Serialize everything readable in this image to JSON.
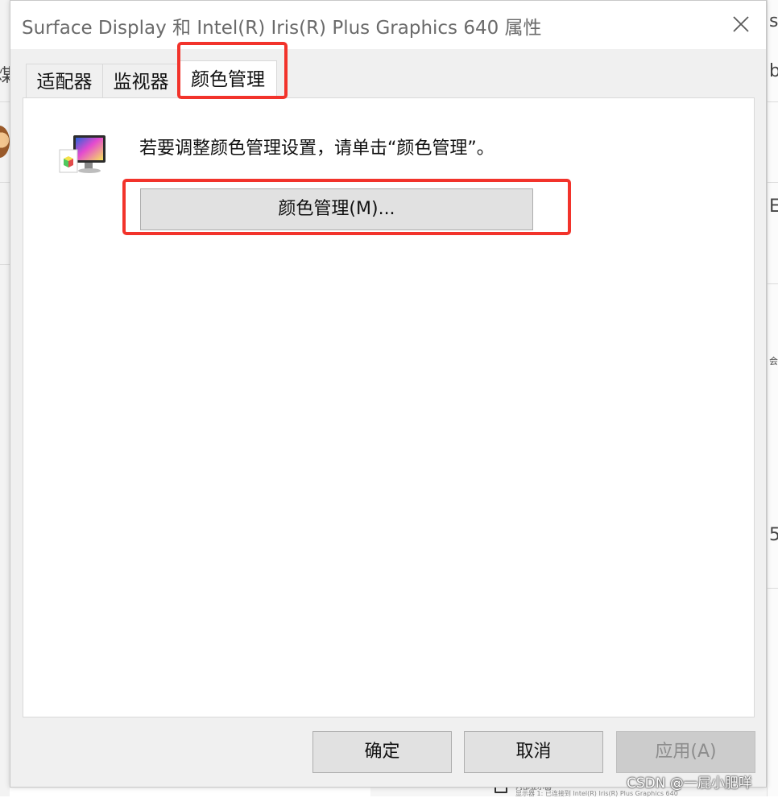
{
  "dialog": {
    "title": "Surface Display 和 Intel(R) Iris(R) Plus Graphics 640 属性",
    "close_glyph": "✕"
  },
  "tabs": [
    {
      "label": "适配器"
    },
    {
      "label": "监视器"
    },
    {
      "label": "颜色管理",
      "active": true
    }
  ],
  "panel": {
    "icon": "monitor-color-icon",
    "instruction": "若要调整颜色管理设置，请单击“颜色管理”。",
    "color_management_button": "颜色管理(M)..."
  },
  "footer": {
    "ok": "确定",
    "cancel": "取消",
    "apply": "应用(A)",
    "apply_disabled": true
  },
  "background": {
    "left_fragment": "煤",
    "right_fragment_top": "s",
    "right_fragment_mid": "b",
    "right_fragment_list": "E",
    "right_fragment_small": "会",
    "right_fragment_low": "5",
    "status_line_1": "内部显示器",
    "status_line_2": "显示器 1: 已连接到 Intel(R) Iris(R) Plus Graphics 640"
  },
  "watermark": "CSDN @一屁小肥咩",
  "colors": {
    "highlight": "#f2332b",
    "dialog_bg": "#f0f0f0",
    "button_bg": "#e1e1e1",
    "disabled_text": "#8d8d8d"
  }
}
